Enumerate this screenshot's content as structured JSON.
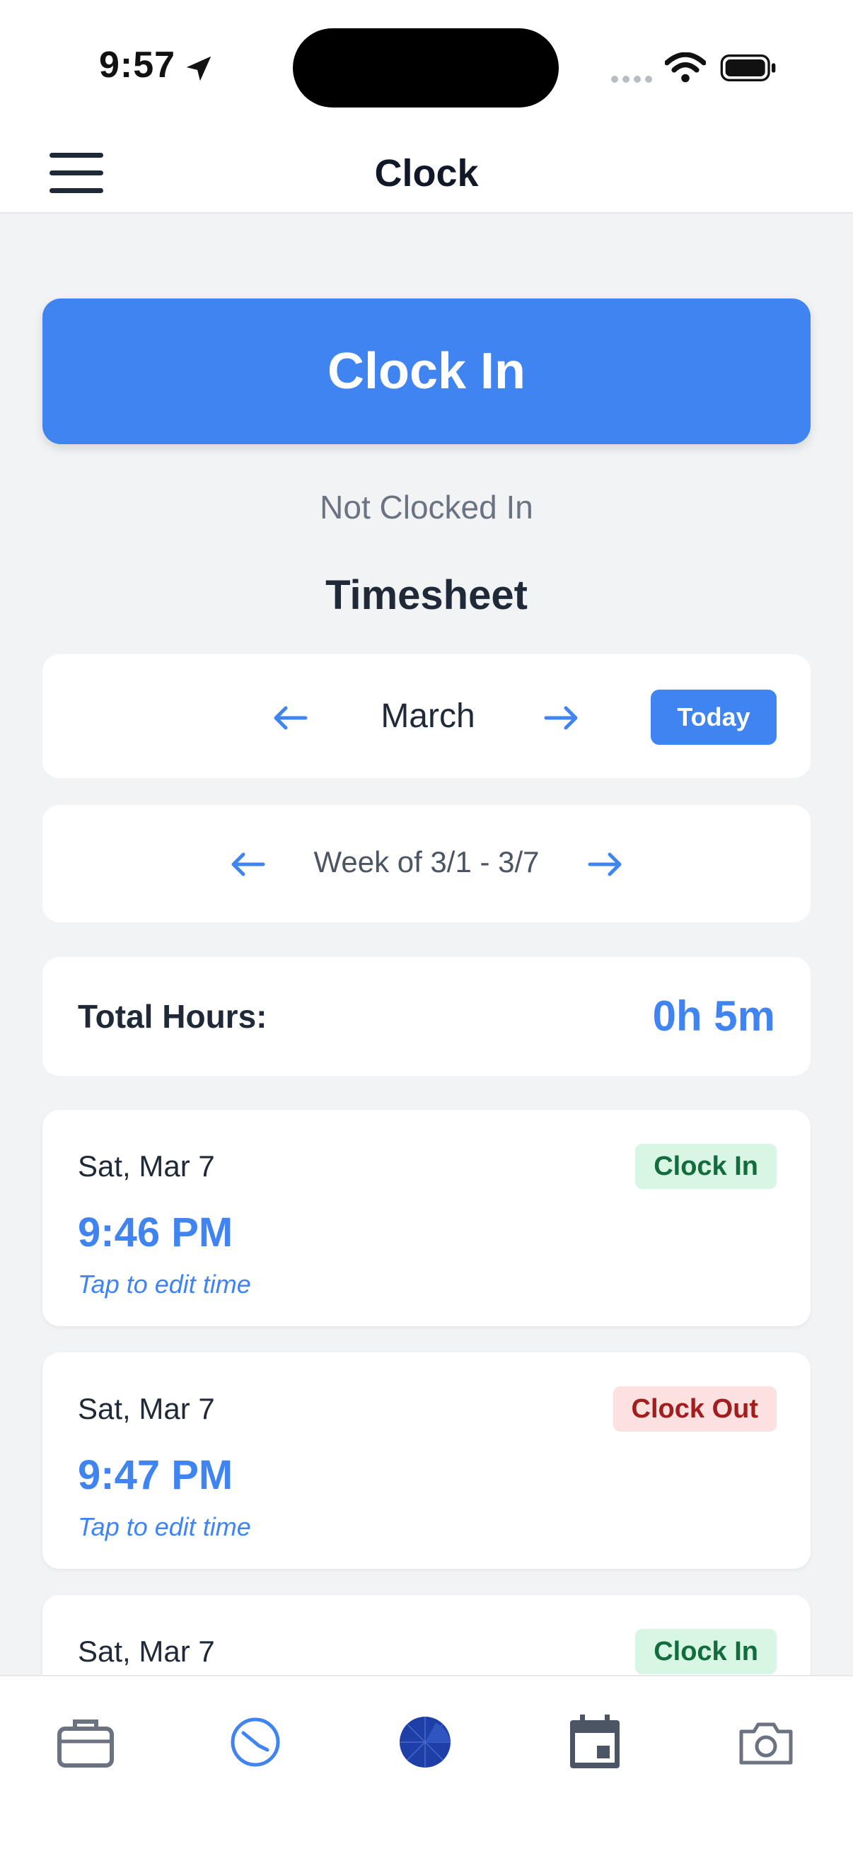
{
  "status_bar": {
    "time": "9:57"
  },
  "header": {
    "title": "Clock"
  },
  "clock": {
    "button_label": "Clock In",
    "status": "Not Clocked In"
  },
  "timesheet": {
    "title": "Timesheet",
    "month": "March",
    "today_label": "Today",
    "week_label": "Week of 3/1 - 3/7",
    "total_label": "Total Hours:",
    "total_value": "0h 5m",
    "entries": [
      {
        "date": "Sat, Mar 7",
        "type": "Clock In",
        "time": "9:46 PM",
        "hint": "Tap to edit time"
      },
      {
        "date": "Sat, Mar 7",
        "type": "Clock Out",
        "time": "9:47 PM",
        "hint": "Tap to edit time"
      },
      {
        "date": "Sat, Mar 7",
        "type": "Clock In"
      }
    ]
  },
  "tabbar": {
    "items": [
      "briefcase-icon",
      "clock-icon",
      "globe-icon",
      "calendar-icon",
      "camera-icon"
    ],
    "active": "clock-icon"
  },
  "colors": {
    "accent": "#3f84f0",
    "clock_in_badge": "#d7f6e3",
    "clock_out_badge": "#fde0e0"
  }
}
